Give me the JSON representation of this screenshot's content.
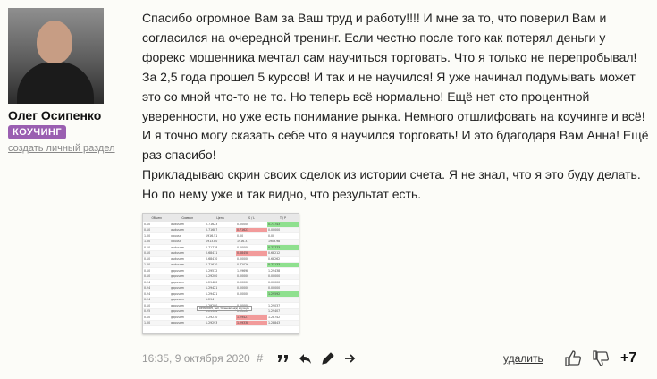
{
  "author": {
    "name": "Олег Осипенко",
    "badge": "КОУЧИНГ",
    "create_link": "создать личный раздел"
  },
  "comment": {
    "paragraphs": [
      "Спасибо огромное Вам за Ваш труд и работу!!!! И мне за то, что поверил Вам и согласился на очередной тренинг. Если честно после того как потерял деньги у форекс мошенника мечтал сам научиться торговать. Что я только не перепробывал! За 2,5 года прошел 5 курсов! И так и не научился! Я уже начинал подумывать может это со мной что-то не то. Но теперь всё нормально! Ещё нет сто процентной уверенности, но уже есть понимание рынка. Немного отшлифовать на коучинге и всё! И я точно могу сказать себе что я научился торговать! И это бдагодаря Вам Анна! Ещё раз спасибо!",
      "Прикладываю скрин своих сделок из истории счета. Я не знал, что я это буду делать. Но по нему уже и так видно, что результат есть."
    ]
  },
  "attachment": {
    "headers": [
      "Объем",
      "Символ",
      "Цена",
      "S / L",
      "T / P"
    ],
    "rows": [
      [
        "0.10",
        "audusdm",
        "0.71623",
        "0.00000",
        "0.71743"
      ],
      [
        "0.10",
        "audusdm",
        "0.71687",
        "0.71623",
        "0.00000"
      ],
      [
        "1.00",
        "xauusd",
        "1916.51",
        "0.00",
        "0.00"
      ],
      [
        "1.00",
        "xauusd",
        "1913.80",
        "1916.37",
        "1903.98"
      ],
      [
        "0.10",
        "audusdm",
        "0.71718",
        "0.00000",
        "0.71773"
      ],
      [
        "0.10",
        "audusdm",
        "0.68411",
        "0.68458",
        "0.68212"
      ],
      [
        "0.10",
        "audusdm",
        "0.68410",
        "0.00000",
        "0.68262"
      ],
      [
        "1.00",
        "audusdm",
        "0.71610",
        "0.72026",
        "0.71133"
      ],
      [
        "0.10",
        "gbpusdm",
        "1.29572",
        "1.29698",
        "1.29438"
      ],
      [
        "0.10",
        "gbpusdm",
        "1.29200",
        "0.00000",
        "0.00000"
      ],
      [
        "0.24",
        "gbpusdm",
        "1.29480",
        "0.00000",
        "0.00000"
      ],
      [
        "0.24",
        "gbpusdm",
        "1.29421",
        "0.00000",
        "0.00000"
      ],
      [
        "0.24",
        "gbpusdm",
        "1.29421",
        "0.00000",
        "1.29592"
      ],
      [
        "0.24",
        "gbpusdm",
        "1.294",
        "",
        ""
      ],
      [
        "0.10",
        "gbpusdm",
        "1.29290",
        "0.00000",
        "1.29037"
      ],
      [
        "0.25",
        "gbpusdm",
        "1.29366",
        "0.00000",
        "1.29407"
      ],
      [
        "0.10",
        "gbpusdm",
        "1.29210",
        "1.29427",
        "1.28742"
      ],
      [
        "1.00",
        "gbpusdm",
        "1.29293",
        "1.29338",
        "1.28843"
      ]
    ],
    "tooltip": "#45606005, Sell, Установлен(а) вручную"
  },
  "footer": {
    "timestamp": "16:35, 9 октября 2020",
    "hash": "#",
    "delete": "удалить",
    "rating": "+7"
  },
  "colors": {
    "badge_bg": "#9a5fb1",
    "loss": "#f29b9b",
    "profit": "#8fe08f"
  },
  "icons": [
    "quote-icon",
    "reply-icon",
    "edit-icon",
    "forward-icon",
    "thumbs-up-icon",
    "thumbs-down-icon"
  ]
}
